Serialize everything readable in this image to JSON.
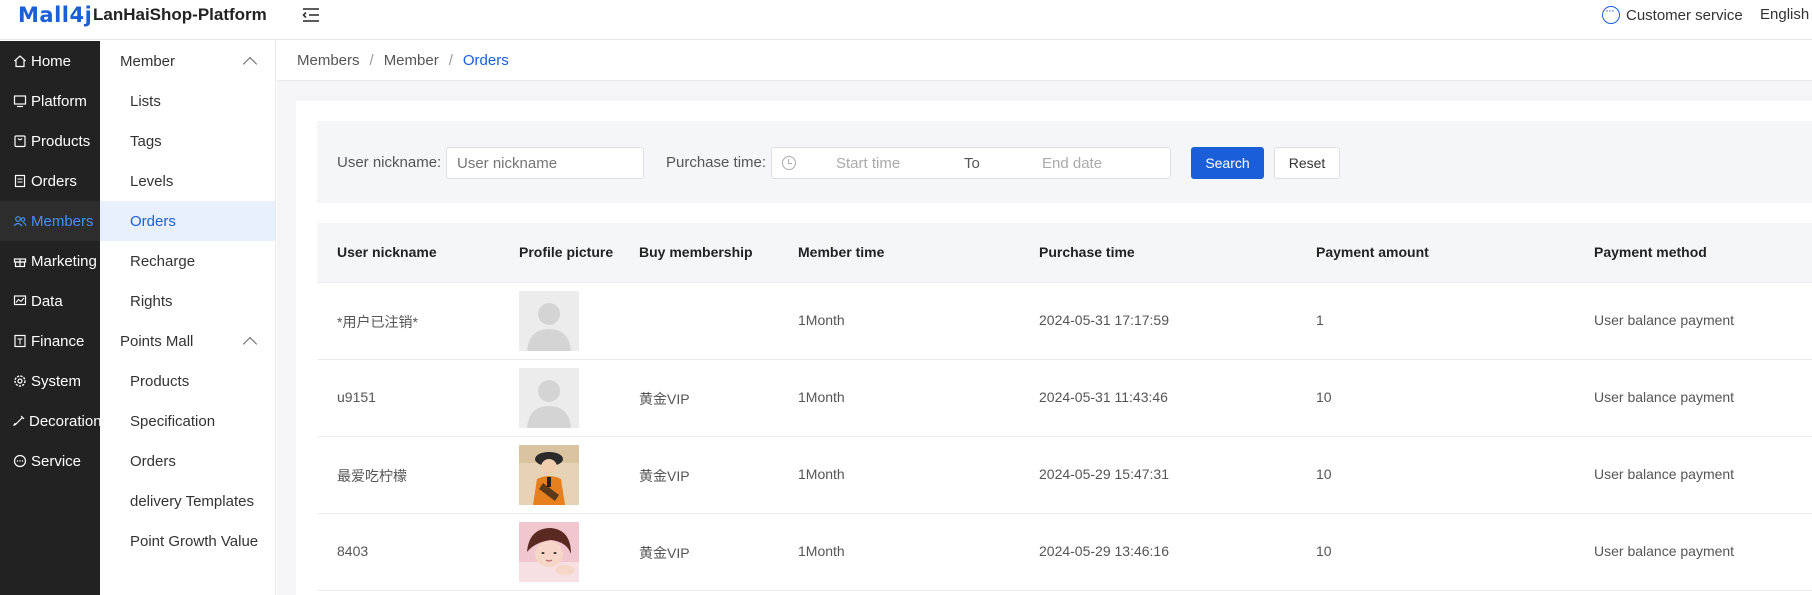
{
  "header": {
    "logo": "Mall4j",
    "platform_name": "LanHaiShop-Platform",
    "customer_service": "Customer service",
    "language": "English"
  },
  "sidebar": {
    "items": [
      {
        "label": "Home",
        "icon": "home-icon"
      },
      {
        "label": "Platform",
        "icon": "monitor-icon"
      },
      {
        "label": "Products",
        "icon": "bag-icon"
      },
      {
        "label": "Orders",
        "icon": "document-icon"
      },
      {
        "label": "Members",
        "icon": "users-icon",
        "active": true
      },
      {
        "label": "Marketing",
        "icon": "gift-icon"
      },
      {
        "label": "Data",
        "icon": "chart-icon"
      },
      {
        "label": "Finance",
        "icon": "finance-icon"
      },
      {
        "label": "System",
        "icon": "gear-icon"
      },
      {
        "label": "Decoration",
        "icon": "brush-icon"
      },
      {
        "label": "Service",
        "icon": "chat-icon"
      }
    ]
  },
  "submenu": {
    "group1": "Member",
    "group1_items": [
      "Lists",
      "Tags",
      "Levels",
      "Orders",
      "Recharge",
      "Rights"
    ],
    "group2": "Points Mall",
    "group2_items": [
      "Products",
      "Specification",
      "Orders",
      "delivery Templates",
      "Point Growth Value"
    ]
  },
  "breadcrumb": [
    "Members",
    "Member",
    "Orders"
  ],
  "filter": {
    "nickname_label": "User nickname:",
    "nickname_placeholder": "User nickname",
    "purchase_label": "Purchase time:",
    "start_placeholder": "Start time",
    "to_label": "To",
    "end_placeholder": "End date",
    "search_label": "Search",
    "reset_label": "Reset"
  },
  "table": {
    "columns": [
      "User nickname",
      "Profile picture",
      "Buy membership",
      "Member time",
      "Purchase time",
      "Payment amount",
      "Payment method"
    ],
    "rows": [
      {
        "nickname": "*用户已注销*",
        "avatar": "default",
        "membership": "",
        "member_time": "1Month",
        "purchase_time": "2024-05-31 17:17:59",
        "amount": "1",
        "method": "User balance payment"
      },
      {
        "nickname": "u9151",
        "avatar": "default",
        "membership": "黄金VIP",
        "member_time": "1Month",
        "purchase_time": "2024-05-31 11:43:46",
        "amount": "10",
        "method": "User balance payment"
      },
      {
        "nickname": "最爱吃柠檬",
        "avatar": "photo-guitar",
        "membership": "黄金VIP",
        "member_time": "1Month",
        "purchase_time": "2024-05-29 15:47:31",
        "amount": "10",
        "method": "User balance payment"
      },
      {
        "nickname": "8403",
        "avatar": "photo-girl",
        "membership": "黄金VIP",
        "member_time": "1Month",
        "purchase_time": "2024-05-29 13:46:16",
        "amount": "10",
        "method": "User balance payment"
      }
    ]
  },
  "colors": {
    "accent": "#1b5fd8",
    "sidebar_bg": "#222222",
    "active_sub_bg": "#e8f0fd"
  }
}
